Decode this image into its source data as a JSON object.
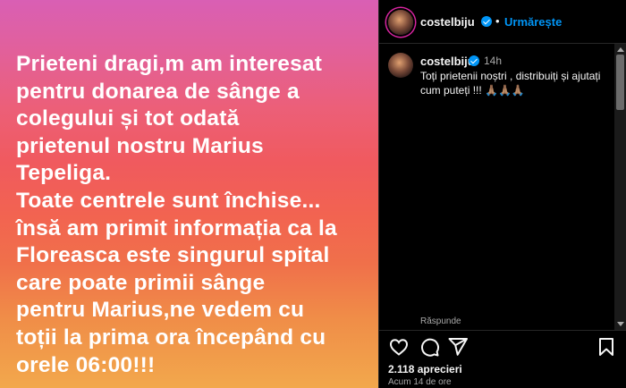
{
  "post": {
    "image_text": "Prieteni dragi,m am interesat\npentru donarea de sânge a\ncolegului și tot odată\nprietenul nostru Marius\nTepeliga.\nToate centrele sunt închise...\nînsă am primit informația ca la\nFloreasca este singurul spital\ncare poate primii sânge\npentru Marius,ne vedem cu\ntoții la prima ora începând cu\norele 06:00!!!",
    "gradient_colors": [
      "#d95fb4",
      "#ec5f78",
      "#f05a5e",
      "#f08d48",
      "#f2a84c"
    ]
  },
  "header": {
    "username": "costelbiju",
    "separator": "•",
    "follow_label": "Urmărește"
  },
  "caption": {
    "username": "costelbiju",
    "time": "14h",
    "text": "Toți prietenii noștri , distribuiți și ajutați cum puteți !!! 🙏🏽🙏🏽🙏🏽",
    "reply_label": "Răspunde"
  },
  "actions": {
    "icons": [
      "heart-icon",
      "comment-icon",
      "share-icon",
      "bookmark-icon"
    ],
    "likes": "2.118 aprecieri",
    "time_ago": "Acum 14 de ore"
  },
  "colors": {
    "background": "#000000",
    "accent_blue": "#0095f6",
    "muted_text": "#a8a8a8",
    "divider": "#262626"
  }
}
